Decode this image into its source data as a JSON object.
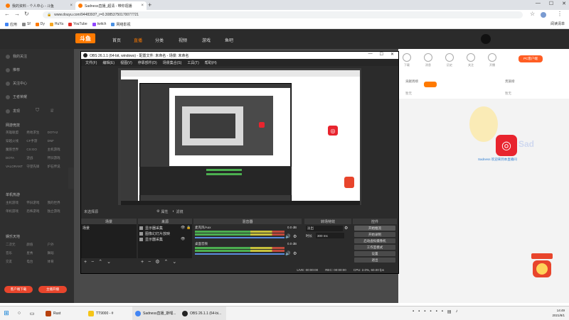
{
  "chrome": {
    "tabs": [
      {
        "title": "我的资料 - 个人中心 - 斗鱼",
        "fav_color": "#ff7a00"
      },
      {
        "title": "Sadness直播_超清 - 带你逛播",
        "fav_color": "#ff7a00"
      }
    ],
    "new_tab": "+",
    "win_controls": [
      "—",
      "☐",
      "✕"
    ],
    "url": "www.douyu.com/9448393?_r=0.30853750170077721",
    "nav": {
      "back": "←",
      "forward": "→",
      "reload": "↻"
    },
    "bookmarks": [
      {
        "label": "应用",
        "color": "#4285f4"
      },
      {
        "label": "Sf",
        "color": "#888888"
      },
      {
        "label": "Dy",
        "color": "#ff7a00"
      },
      {
        "label": "HuYa",
        "color": "#f5a623"
      },
      {
        "label": "YouTube",
        "color": "#e52d27"
      },
      {
        "label": "twitch",
        "color": "#9146ff"
      },
      {
        "label": "网络影视",
        "color": "#4a90e2"
      }
    ],
    "reading_list": "阅读清单"
  },
  "douyu": {
    "logo": "斗鱼",
    "nav": [
      "首页",
      "直播",
      "分类",
      "视频",
      "游戏",
      "鱼吧"
    ],
    "sidebar": {
      "items": [
        "我的关注",
        "推荐",
        "关注中心",
        "王者荣耀",
        "发现"
      ],
      "section1": "网游竞技",
      "games1": [
        "英雄联盟",
        "绝地求生",
        "DOTA2",
        "穿越火线",
        "CF手游",
        "DNF",
        "魔兽世界",
        "CS:GO",
        "主机游戏",
        "DOTA",
        "逆战",
        "怀旧游戏",
        "VALORANT",
        "守望先锋",
        "炉石传说"
      ],
      "section2": "单机热游",
      "games2": [
        "主机游戏",
        "怀旧游戏",
        "我的世界",
        "单机游戏",
        "恐怖游戏",
        "独立游戏"
      ],
      "section3": "娱乐天地",
      "games3": [
        "二次元",
        "颜值",
        "户外",
        "音乐",
        "星秀",
        "舞蹈",
        "交友",
        "电台",
        "体育"
      ],
      "btn_left": "客户端下载",
      "btn_right": "主播开播"
    },
    "right": {
      "icons": [
        "下载",
        "消息",
        "历史",
        "关注",
        "开播"
      ],
      "pc_button": "PC客户端",
      "rank_tabs": [
        "贡献周榜",
        "贵族榜"
      ],
      "rank_labels": [
        "暂无",
        "暂无"
      ],
      "welcome": "Sadness 欢迎来到本直播间"
    }
  },
  "obs": {
    "title": "OBS 26.1.1 (64-bit, windows) - 配置文件: 未命名 - 场景: 未命名",
    "menu": [
      "文件(F)",
      "编辑(E)",
      "视图(V)",
      "停靠部件(D)",
      "场景集合(S)",
      "工具(T)",
      "帮助(H)"
    ],
    "no_source": "未选择源",
    "props": "属性",
    "filters": "滤镜",
    "docks": {
      "scenes": "场景",
      "sources": "来源",
      "mixer": "混音器",
      "transitions": "转场特效",
      "controls": "控件"
    },
    "scene_items": [
      "场景"
    ],
    "source_items": [
      "显示器采集",
      "图像幻灯片放映",
      "显示器采集"
    ],
    "mixer": [
      {
        "name": "麦克风/Aux",
        "db": "0.0 dB"
      },
      {
        "name": "桌面音频",
        "db": "0.0 dB"
      }
    ],
    "transition": {
      "type": "淡出",
      "duration_label": "时长",
      "duration": "300 ms"
    },
    "controls": [
      "开始推流",
      "开始录制",
      "启动虚拟摄像机",
      "工作室模式",
      "设置",
      "退出"
    ],
    "status": {
      "live": "LIVE: 00:00:00",
      "rec": "REC: 00:00:00",
      "cpu": "CPU: 2.0%, 60.00 fps"
    }
  },
  "taskbar": {
    "items": [
      {
        "label": "Rust",
        "color": "#b7410e"
      },
      {
        "label": "TT9000 - #",
        "color": "#f5c518"
      },
      {
        "label": "Sadness直播_斯嘿...",
        "color": "#4285f4"
      },
      {
        "label": "OBS 26.1.1 (64-bi...",
        "color": "#222222"
      }
    ],
    "time": "14:49",
    "date": "2021/8/1"
  }
}
